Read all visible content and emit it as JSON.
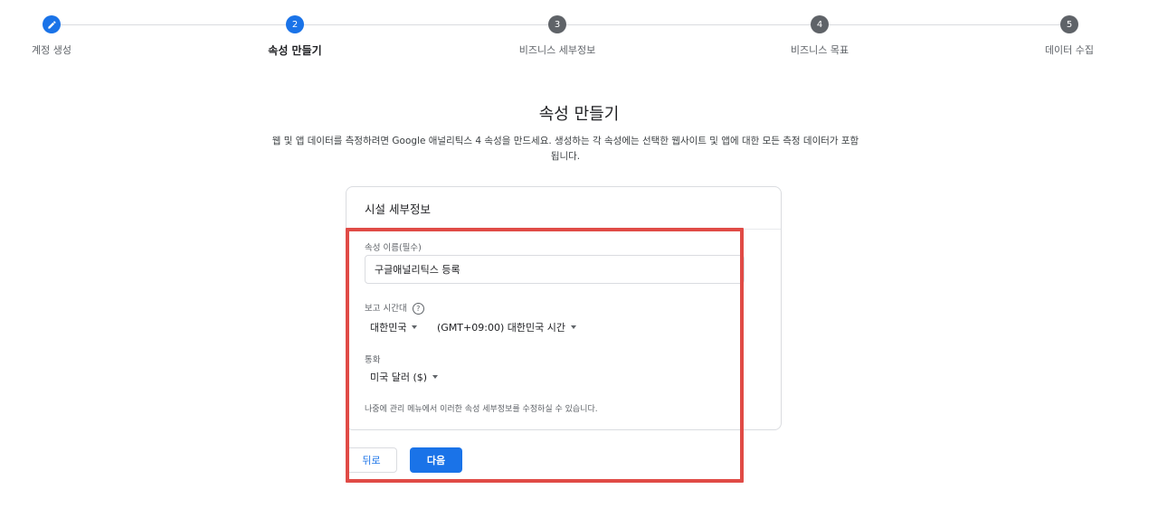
{
  "stepper": {
    "steps": [
      {
        "number": "",
        "icon": "pencil-icon",
        "label": "계정 생성",
        "state": "completed"
      },
      {
        "number": "2",
        "label": "속성 만들기",
        "state": "active"
      },
      {
        "number": "3",
        "label": "비즈니스 세부정보",
        "state": "pending"
      },
      {
        "number": "4",
        "label": "비즈니스 목표",
        "state": "pending"
      },
      {
        "number": "5",
        "label": "데이터 수집",
        "state": "pending"
      }
    ]
  },
  "page": {
    "title": "속성 만들기",
    "description": "웹 및 앱 데이터를 측정하려면 Google 애널리틱스 4 속성을 만드세요. 생성하는 각 속성에는 선택한 웹사이트 및 앱에 대한 모든 측정 데이터가 포함됩니다."
  },
  "card": {
    "title": "시설 세부정보",
    "property_name_label": "속성 이름(필수)",
    "property_name_value": "구글애널리틱스 등록",
    "timezone_label": "보고 시간대",
    "timezone_country": "대한민국",
    "timezone_zone": "(GMT+09:00) 대한민국 시간",
    "currency_label": "통화",
    "currency_value": "미국 달러 ($)",
    "note": "나중에 관리 메뉴에서 이러한 속성 세부정보를 수정하실 수 있습니다."
  },
  "footer": {
    "back_label": "뒤로",
    "next_label": "다음"
  },
  "colors": {
    "accent": "#1a73e8",
    "inactive_step": "#5f6368",
    "highlight": "#e04b46"
  }
}
